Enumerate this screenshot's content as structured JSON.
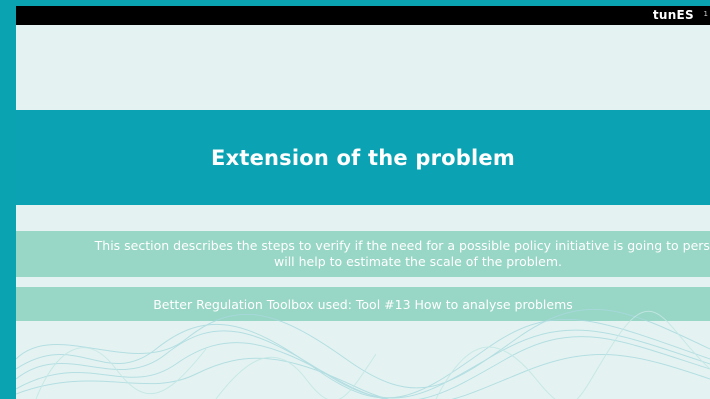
{
  "header": {
    "logo_main": "tunES",
    "page_number": "1"
  },
  "main": {
    "title": "Extension of the problem",
    "description": "This section describes the steps to verify if the need for a possible policy initiative is going to persist. It will help to estimate the scale of the problem.",
    "toolbox_note": "Better Regulation Toolbox used: Tool #13 How to analyse problems"
  },
  "colors": {
    "frame": "#0aa3b1",
    "slide_bg": "#e4f3f1",
    "title_band": "#0ba3b3",
    "text_band": "#98d6c5",
    "topbar": "#000000"
  }
}
